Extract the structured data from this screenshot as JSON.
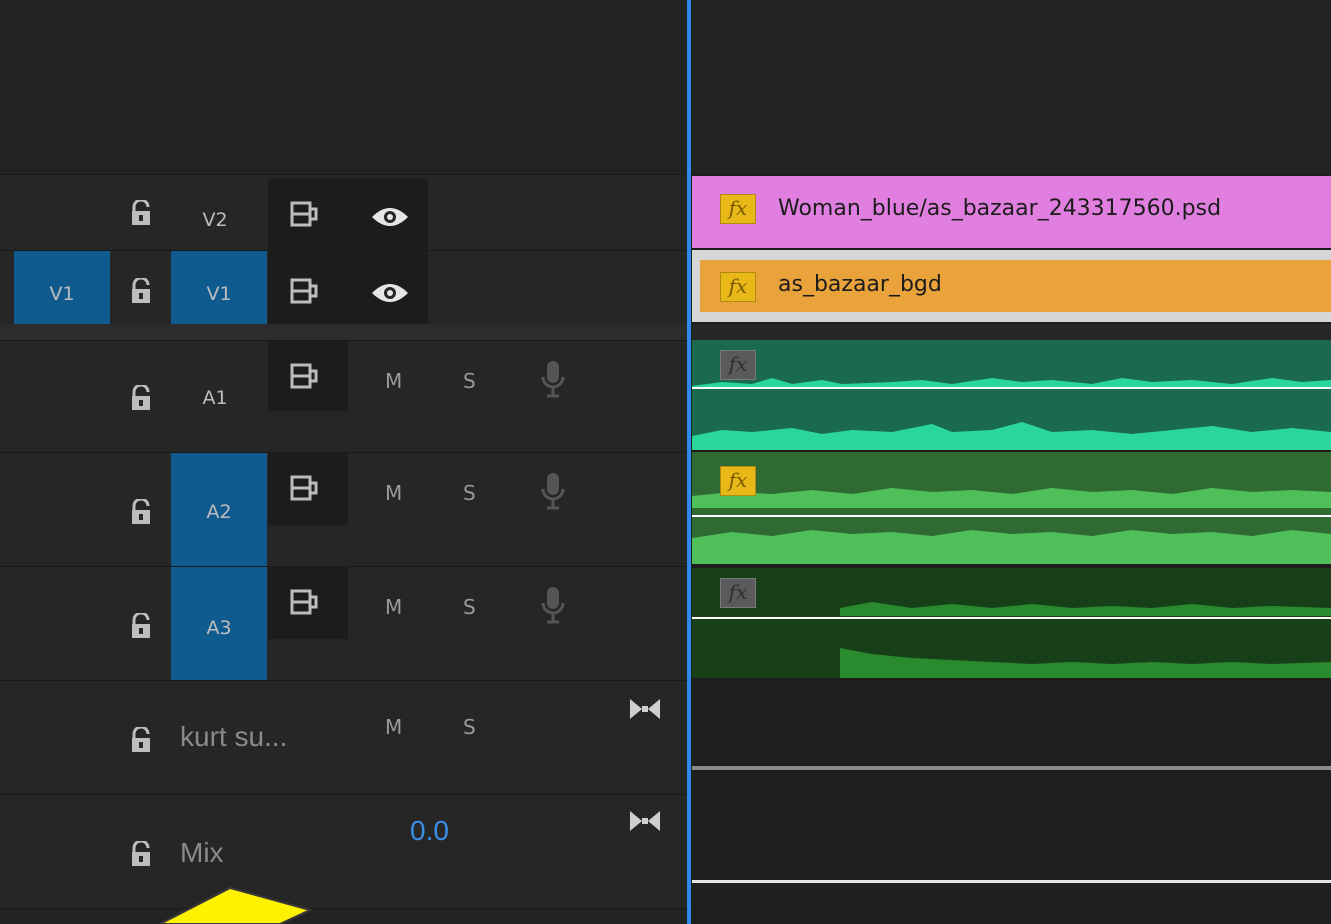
{
  "tracks": {
    "v2": {
      "label": "V2"
    },
    "v1": {
      "label": "V1",
      "source_label": "V1"
    },
    "a1": {
      "label": "A1",
      "mute": "M",
      "solo": "S"
    },
    "a2": {
      "label": "A2",
      "mute": "M",
      "solo": "S"
    },
    "a3": {
      "label": "A3",
      "mute": "M",
      "solo": "S"
    },
    "submix": {
      "label": "kurt su...",
      "mute": "M",
      "solo": "S"
    },
    "mix": {
      "label": "Mix",
      "value": "0.0"
    }
  },
  "clips": {
    "v2": {
      "name": "Woman_blue/as_bazaar_243317560.psd",
      "fx": "fx",
      "color": "#e17fe0"
    },
    "v1": {
      "name": "as_bazaar_bgd",
      "fx": "fx",
      "color": "#eaa33a"
    },
    "a1": {
      "fx": "fx",
      "color": "#1a6b4d",
      "wave": "#2bd69a"
    },
    "a2": {
      "fx": "fx",
      "color": "#2f6a33",
      "wave": "#4fbf5a"
    },
    "a3": {
      "fx": "fx",
      "color": "#173f18",
      "wave": "#2a8a2e"
    }
  },
  "colors": {
    "playhead": "#2d8ceb",
    "track_target": "#0f5a8f",
    "mix_value": "#3a8ee6"
  },
  "icons": [
    "lock-icon",
    "sync-lock-icon",
    "eye-icon",
    "mic-icon",
    "bowtie-icon",
    "pointer-arrow"
  ]
}
